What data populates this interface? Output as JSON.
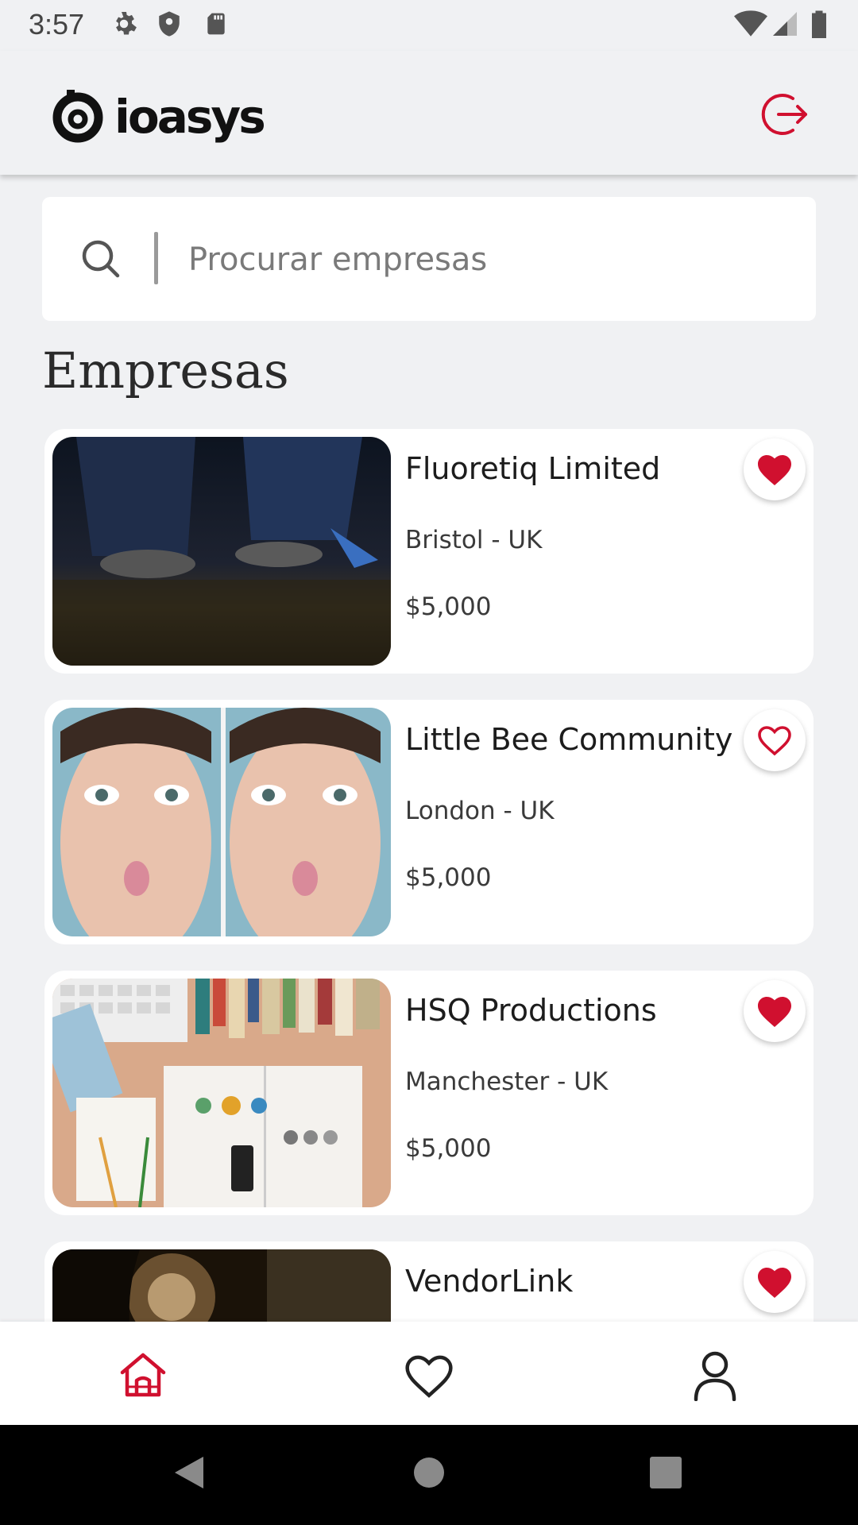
{
  "status_bar": {
    "time": "3:57"
  },
  "app_bar": {
    "logo_text": "ioasys"
  },
  "search": {
    "placeholder": "Procurar empresas",
    "value": ""
  },
  "section_title": "Empresas",
  "companies": [
    {
      "name": "Fluoretiq Limited",
      "location": "Bristol - UK",
      "price": "$5,000",
      "favorite": true
    },
    {
      "name": "Little Bee Community",
      "location": "London - UK",
      "price": "$5,000",
      "favorite": false
    },
    {
      "name": "HSQ Productions",
      "location": "Manchester - UK",
      "price": "$5,000",
      "favorite": true
    },
    {
      "name": "VendorLink",
      "location": "",
      "price": "",
      "favorite": true
    }
  ],
  "bottom_nav": {
    "items": [
      "home-icon",
      "heart-icon",
      "profile-icon"
    ],
    "active": "home-icon"
  },
  "colors": {
    "accent": "#d0102f",
    "background": "#f0f1f3",
    "card": "#ffffff"
  }
}
